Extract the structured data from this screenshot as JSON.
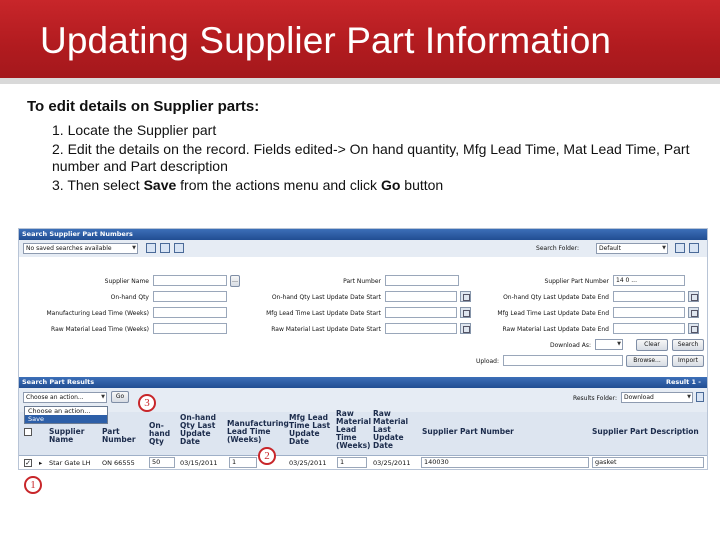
{
  "slide": {
    "title": "Updating Supplier Part Information",
    "intro": "To edit details on Supplier parts:",
    "steps": [
      "1. Locate the Supplier part",
      "2. Edit the details on the record. Fields edited-> On hand quantity, Mfg Lead Time, Mat Lead Time, Part number and Part description",
      "3. Then select ",
      "Save",
      " from the actions menu and click ",
      "Go",
      " button"
    ]
  },
  "search_panel": {
    "title": "Search Supplier Part Numbers",
    "saved_search": "No saved searches available",
    "search_folder_label": "Search Folder:",
    "search_folder_value": "Default",
    "labels": {
      "supplier_name": "Supplier Name",
      "onhand_qty": "On-hand Qty",
      "mfg_lead_time": "Manufacturing Lead Time (Weeks)",
      "raw_material_lead_time": "Raw Material Lead Time (Weeks)",
      "part_number": "Part Number",
      "onhand_qty_last_update_start": "On-hand Qty Last Update Date Start",
      "mfg_lead_time_last_update_start": "Mfg Lead Time Last Update Date Start",
      "raw_material_last_update_start": "Raw Material Last Update Date Start",
      "supplier_part_number": "Supplier Part Number",
      "onhand_qty_last_update_end": "On-hand Qty Last Update Date End",
      "mfg_lead_time_last_update_end": "Mfg Lead Time Last Update Date End",
      "raw_material_last_update_end": "Raw Material Last Update Date End",
      "download_as": "Download As:",
      "upload": "Upload:"
    },
    "supplier_part_number_value": "14 0 ...",
    "clear_label": "Clear",
    "search_label": "Search",
    "browse_label": "Browse...",
    "import_label": "Import"
  },
  "results_panel": {
    "title": "Search Part Results",
    "result_count": "Result 1 -",
    "action_select": "Choose an action...",
    "go_label": "Go",
    "results_folder_label": "Results Folder:",
    "results_folder_value": "Download",
    "menu_items": [
      "Choose an action...",
      "Save"
    ],
    "columns": [
      "Supplier Name",
      "Part Number",
      "On-hand Qty",
      "On-hand Qty Last Update Date",
      "Manufacturing Lead Time (Weeks)",
      "Mfg Lead Time Last Update Date",
      "Raw Material Lead Time (Weeks)",
      "Raw Material Last Update Date",
      "Supplier Part Number",
      "Supplier Part Description"
    ],
    "row": {
      "supplier_name": "Star Gate LH",
      "part_number": "ON 66555",
      "onhand_qty": "50",
      "onhand_date": "03/15/2011",
      "mfg_lead_time": "1",
      "mfg_date": "03/25/2011",
      "raw_lead_time": "1",
      "raw_date": "03/25/2011",
      "supplier_part_number": "140030",
      "description": "gasket"
    }
  },
  "callouts": [
    "1",
    "2",
    "3"
  ],
  "colors": {
    "header_red": "#b11b1f",
    "bar_blue": "#214d92",
    "callout_red": "#c8262a"
  }
}
